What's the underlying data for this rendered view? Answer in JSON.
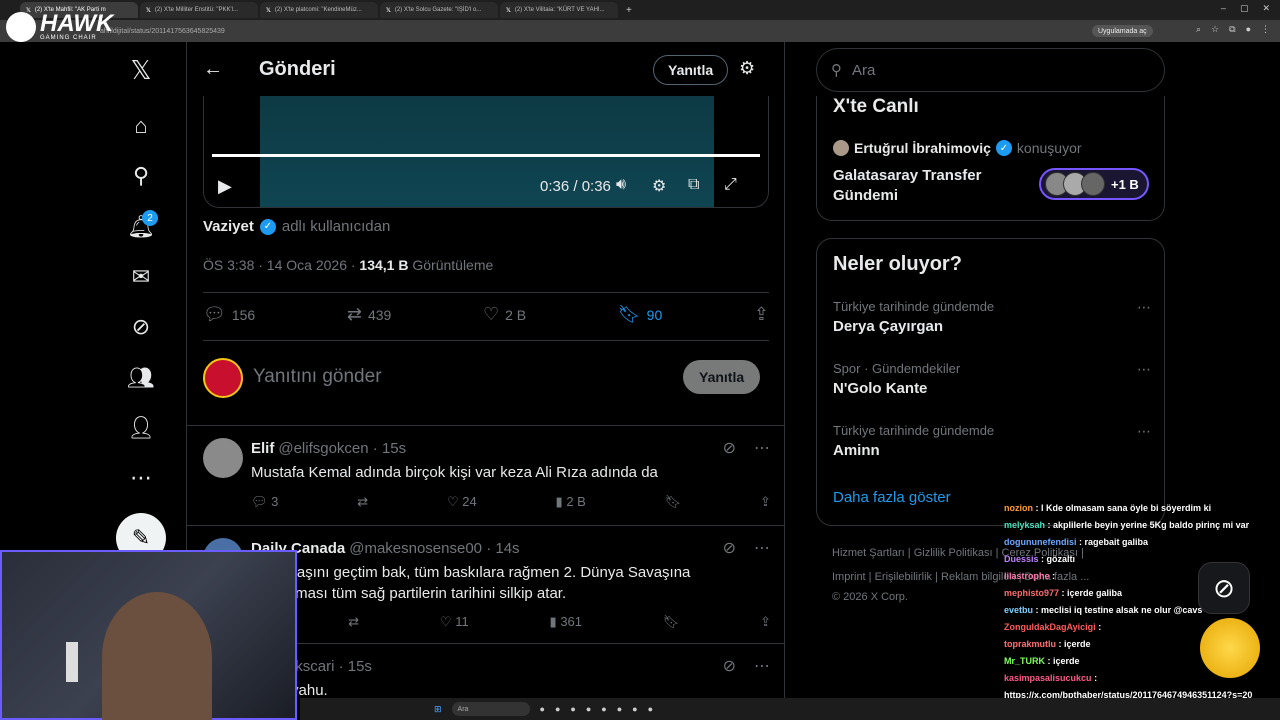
{
  "browser": {
    "tabs": [
      "(2) X'te Mahfil: \"AK Parti m",
      "(2) X'te Milliter Enstitü: \"PKK'l...",
      "(2) X'te platcomi: \"KendineMüz...",
      "(2) X'te Solcu Gazete: \"IŞİD'l o...",
      "(2) X'te Vilitaia: \"KÜRT VE YAHI..."
    ],
    "url": "ahfildijital/status/2011417563645825439",
    "app_button": "Uygulamada aç"
  },
  "logo": {
    "name": "HAWK",
    "sub": "GAMING CHAIR"
  },
  "nav": {
    "notifications_badge": "2",
    "icons": [
      "x-logo-icon",
      "home-icon",
      "search-icon",
      "bell-icon",
      "mail-icon",
      "grok-icon",
      "communities-icon",
      "profile-icon",
      "more-icon"
    ]
  },
  "header": {
    "title": "Gönderi",
    "reply_button": "Yanıtla"
  },
  "video": {
    "time": "0:36 / 0:36"
  },
  "post": {
    "source_user": "Vaziyet",
    "source_suffix": "adlı kullanıcıdan",
    "time": "ÖS 3:38 · 14 Oca 2026 ·",
    "views": "134,1 B",
    "views_label": "Görüntüleme",
    "replies": "156",
    "reposts": "439",
    "likes": "2 B",
    "bookmarks": "90"
  },
  "reply_box": {
    "placeholder": "Yanıtını gönder",
    "button": "Yanıtla"
  },
  "replies": [
    {
      "name": "Elif",
      "handle": "@elifsgokcen · 15s",
      "text": "Mustafa Kemal adında birçok kişi var keza Ali Rıza adında da",
      "replies": "3",
      "reposts": "",
      "likes": "24",
      "views": "2 B"
    },
    {
      "name": "Daily Canada",
      "handle": "@makesnosense00 · 14s",
      "text": "uş Savaşını geçtim bak, tüm baskılara rağmen 2. Dünya Savaşına\nsokmaması tüm sağ partilerin tarihini silkip atar.",
      "replies": "",
      "reposts": "",
      "likes": "11",
      "views": "361"
    },
    {
      "name": "na",
      "handle": "@skscari · 15s",
      "text": "alaka yahu."
    }
  ],
  "right": {
    "search_placeholder": "Ara",
    "live": {
      "title": "X'te Canlı",
      "user": "Ertuğrul İbrahimoviç",
      "status": "konuşuyor",
      "topic": "Galatasaray Transfer Gündemi",
      "count": "+1 B"
    },
    "trends_title": "Neler oluyor?",
    "trends": [
      {
        "category": "Türkiye tarihinde gündemde",
        "name": "Derya Çayırgan"
      },
      {
        "category": "Spor · Gündemdekiler",
        "name": "N'Golo Kante"
      },
      {
        "category": "Türkiye tarihinde gündemde",
        "name": "Aminn"
      }
    ],
    "show_more": "Daha fazla göster",
    "footer": {
      "line1": "Hizmet Şartları  |  Gizlilik Politikası  |  Çerez Politikası  |",
      "line2": "Imprint  |  Erişilebilirlik  |  Reklam bilgileri  |  Daha fazla ...",
      "line3": "© 2026 X Corp."
    }
  },
  "chat": [
    {
      "user": "nozion",
      "color": "#ff9a3c",
      "text": "l Kde olmasam sana öyle bi söyerdim ki"
    },
    {
      "user": "melyksah",
      "color": "#4ae0c0",
      "text": "akplilerle beyin yerine 5Kg baldo pirinç mi var"
    },
    {
      "user": "dogununefendisi",
      "color": "#6aa8ff",
      "text": "ragebait galiba"
    },
    {
      "user": "Duessis",
      "color": "#c080ff",
      "text": "gözaltı"
    },
    {
      "user": "lilastrophe",
      "color": "#ff7ab0",
      "text": ""
    },
    {
      "user": "mephisto977",
      "color": "#ff6b6b",
      "text": "içerde galiba"
    },
    {
      "user": "evetbu",
      "color": "#7fd0ff",
      "text": "meclisi iq testine alsak ne olur @cavs"
    },
    {
      "user": "ZonguldakDagAyicigi",
      "color": "#ff5a5a",
      "text": ""
    },
    {
      "user": "toprakmutlu",
      "color": "#ff7070",
      "text": "içerde"
    },
    {
      "user": "Mr_TURK",
      "color": "#7cff5a",
      "text": "içerde"
    },
    {
      "user": "kasimpasalisucukcu",
      "color": "#ff5a8a",
      "text": ""
    },
    {
      "user": "",
      "color": "#ffffff",
      "text": "https://x.com/bpthaber/status/2011764674946351124?s=20"
    }
  ],
  "taskbar": {
    "search": "Ara"
  }
}
